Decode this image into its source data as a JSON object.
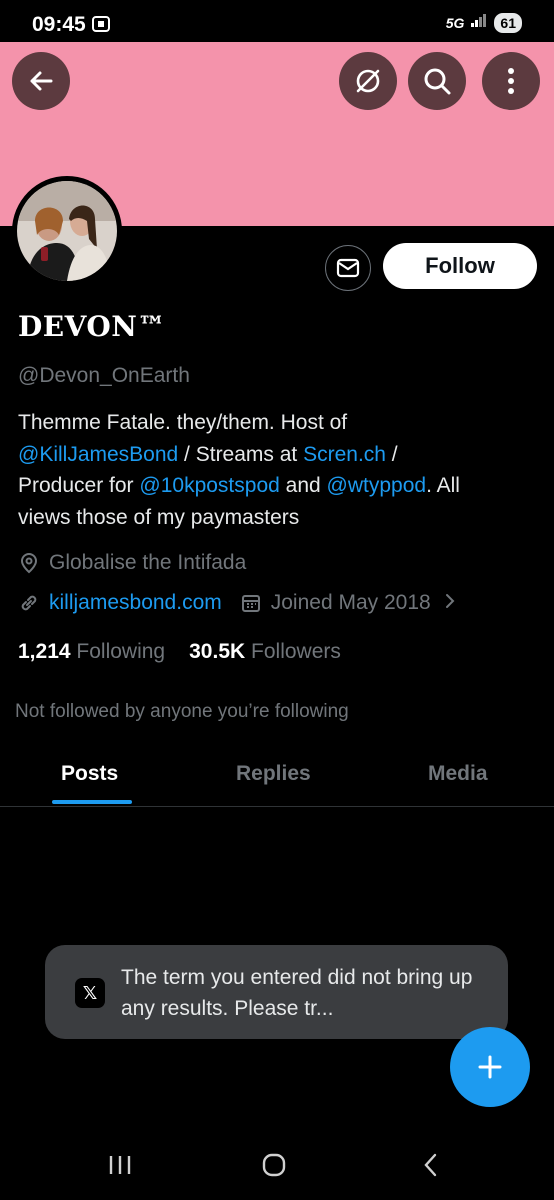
{
  "status_bar": {
    "time": "09:45",
    "network": "5G",
    "battery": "61"
  },
  "profile": {
    "display_name": "DEVON™",
    "handle": "@Devon_OnEarth",
    "follow_label": "Follow",
    "bio": {
      "line1": "Themme Fatale. they/them. Host of",
      "mention1": "@KillJamesBond",
      "text2": " / Streams at ",
      "link1": "Scren.ch",
      "text3": " /",
      "text4": "Producer for ",
      "mention2": "@10kpostspod",
      "text5": " and ",
      "mention3": "@wtyppod",
      "text6": ". All",
      "line4": "views those of my paymasters"
    },
    "location": "Globalise the Intifada",
    "website": "killjamesbond.com",
    "joined": "Joined May 2018",
    "following_count": "1,214",
    "following_label": "Following",
    "followers_count": "30.5K",
    "followers_label": "Followers",
    "not_followed": "Not followed by anyone you’re following"
  },
  "tabs": [
    {
      "label": "Posts",
      "selected": true
    },
    {
      "label": "Replies",
      "selected": false
    },
    {
      "label": "Media",
      "selected": false
    }
  ],
  "toast": {
    "logo": "𝕏",
    "message": "The term you entered did not bring up any results. Please tr..."
  },
  "colors": {
    "banner": "#f493ab",
    "accent": "#1d9bf0",
    "background": "#000000"
  },
  "icons": [
    "back-arrow-icon",
    "grok-icon",
    "search-icon",
    "more-vertical-icon",
    "mail-icon",
    "location-pin-icon",
    "link-icon",
    "calendar-icon",
    "chevron-right-icon",
    "plus-icon",
    "nav-recents-icon",
    "nav-home-icon",
    "nav-back-icon"
  ]
}
